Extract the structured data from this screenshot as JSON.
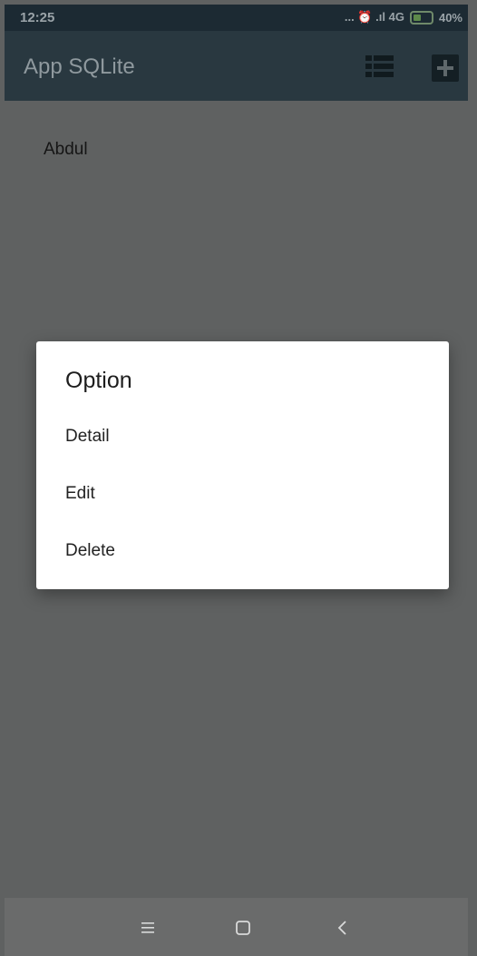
{
  "status_bar": {
    "time": "12:25",
    "indicators": "... ⏰ .ıl 4G",
    "battery_percent": "40%",
    "icons": [
      "more-dots-icon",
      "alarm-icon",
      "signal-icon",
      "battery-charging-icon"
    ]
  },
  "app_bar": {
    "title": "App SQLite",
    "actions": [
      {
        "icon": "list-icon"
      },
      {
        "icon": "add-icon"
      }
    ]
  },
  "list": {
    "items": [
      {
        "label": "Abdul"
      }
    ]
  },
  "dialog": {
    "title": "Option",
    "options": [
      {
        "label": "Detail"
      },
      {
        "label": "Edit"
      },
      {
        "label": "Delete"
      }
    ]
  },
  "nav_bar": {
    "buttons": [
      {
        "icon": "menu-icon"
      },
      {
        "icon": "home-icon"
      },
      {
        "icon": "back-icon"
      }
    ]
  },
  "colors": {
    "app_bar": "#293840",
    "status_bar": "#1c2a33",
    "scrim": "#5f6161",
    "dialog_bg": "#ffffff",
    "nav_bar": "#6a6b6b"
  }
}
